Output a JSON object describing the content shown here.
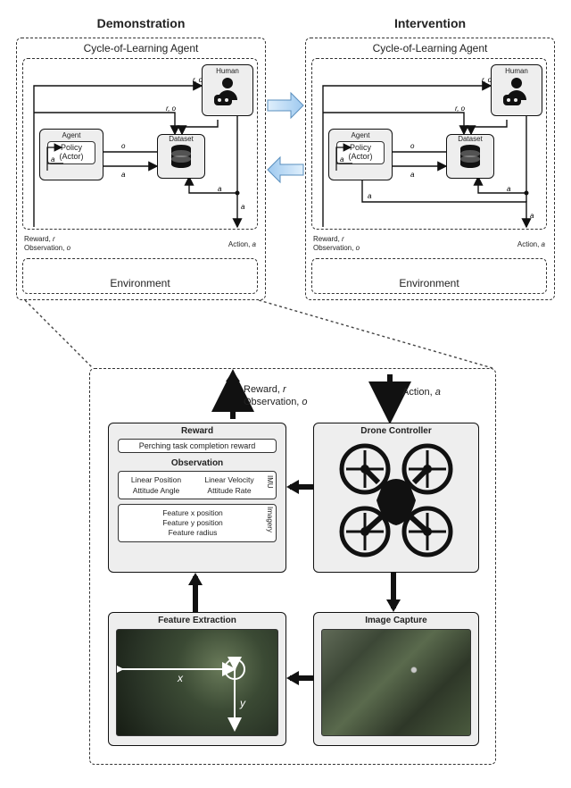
{
  "heading": {
    "left": "Demonstration",
    "right": "Intervention"
  },
  "block": {
    "title": "Cycle-of-Learning Agent",
    "human": "Human",
    "agent": "Agent",
    "policy": "Policy\n(Actor)",
    "dataset": "Dataset",
    "reward_label": "Reward, ",
    "reward_sym": "r",
    "obs_label": "Observation, ",
    "obs_sym": "o",
    "act_label": "Action, ",
    "act_sym": "a",
    "ro": "r, o",
    "a": "a",
    "o": "o",
    "env": "Environment"
  },
  "detail": {
    "action_label": "Action, ",
    "action_sym": "a",
    "reward_label": "Reward, ",
    "reward_sym": "r",
    "obs_label": "Observation, ",
    "obs_sym": "o",
    "reward_box": {
      "title": "Reward",
      "line": "Perching task completion reward"
    },
    "obs_box": {
      "title": "Observation",
      "imu": [
        "Linear Position",
        "Linear Velocity",
        "Attitude Angle",
        "Attitude Rate"
      ],
      "imu_label": "IMU",
      "img": [
        "Feature x position",
        "Feature y position",
        "Feature radius"
      ],
      "img_label": "Imagery"
    },
    "drone": "Drone Controller",
    "feat": "Feature Extraction",
    "cap": "Image Capture",
    "x": "x",
    "y": "y"
  }
}
